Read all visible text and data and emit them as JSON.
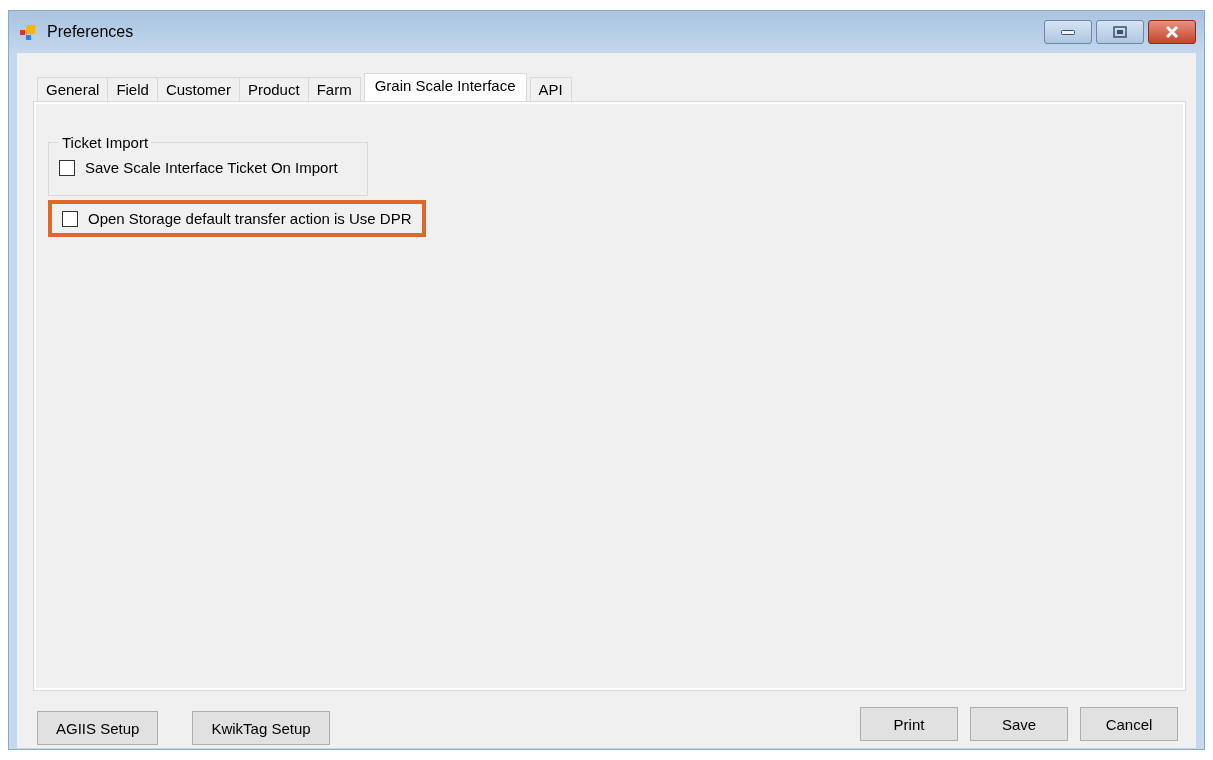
{
  "window": {
    "title": "Preferences"
  },
  "tabs": [
    {
      "label": "General",
      "selected": false
    },
    {
      "label": "Field",
      "selected": false
    },
    {
      "label": "Customer",
      "selected": false
    },
    {
      "label": "Product",
      "selected": false
    },
    {
      "label": "Farm",
      "selected": false
    },
    {
      "label": "Grain Scale Interface",
      "selected": true
    },
    {
      "label": "API",
      "selected": false
    }
  ],
  "group": {
    "title": "Ticket Import",
    "options": [
      {
        "label": "Save Scale Interface Ticket On Import",
        "checked": false,
        "highlighted": false
      }
    ]
  },
  "options": [
    {
      "label": "Open Storage default transfer action is Use DPR",
      "checked": false,
      "highlighted": true
    }
  ],
  "left_buttons": [
    "AGIIS Setup",
    "KwikTag Setup"
  ],
  "right_buttons": [
    "Print",
    "Save",
    "Cancel"
  ]
}
